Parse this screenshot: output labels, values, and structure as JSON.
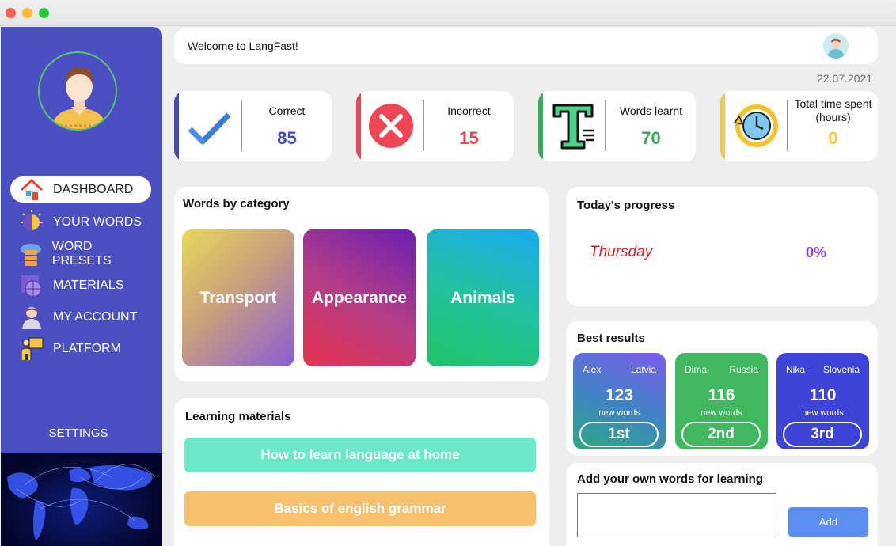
{
  "window": {
    "controls": [
      "close",
      "minimize",
      "maximize"
    ]
  },
  "header": {
    "welcome": "Welcome to LangFast!",
    "date": "22.07.2021"
  },
  "sidebar": {
    "items": [
      {
        "label": "DASHBOARD",
        "icon": "house-icon",
        "active": true
      },
      {
        "label": "YOUR WORDS",
        "icon": "brain-bulb-icon"
      },
      {
        "label": "WORD PRESETS",
        "icon": "server-cloud-icon"
      },
      {
        "label": "MATERIALS",
        "icon": "book-globe-icon"
      },
      {
        "label": "MY ACCOUNT",
        "icon": "user-icon"
      },
      {
        "label": "PLATFORM",
        "icon": "teacher-board-icon"
      }
    ],
    "settings": "SETTINGS"
  },
  "stats": [
    {
      "label": "Correct",
      "value": "85",
      "color": "#3f4ab8",
      "icon": "checkmark-icon"
    },
    {
      "label": "Incorrect",
      "value": "15",
      "color": "#ef4655",
      "icon": "x-circle-icon"
    },
    {
      "label": "Words learnt",
      "value": "70",
      "color": "#3aaa5c",
      "icon": "text-t-icon"
    },
    {
      "label": "Total time spent (hours)",
      "value": "0",
      "color": "#f2c94c",
      "icon": "clock-history-icon"
    }
  ],
  "categories": {
    "title": "Words by category",
    "items": [
      "Transport",
      "Appearance",
      "Animals"
    ]
  },
  "progress": {
    "title": "Today's progress",
    "day": "Thursday",
    "percent": "0%"
  },
  "materials": {
    "title": "Learning materials",
    "items": [
      "How to learn language at home",
      "Basics of english grammar"
    ]
  },
  "results": {
    "title": "Best results",
    "items": [
      {
        "name": "Alex",
        "country": "Latvia",
        "value": "123",
        "unit": "new words",
        "place": "1st"
      },
      {
        "name": "Dima",
        "country": "Russia",
        "value": "116",
        "unit": "new words",
        "place": "2nd"
      },
      {
        "name": "Nika",
        "country": "Slovenia",
        "value": "110",
        "unit": "new words",
        "place": "3rd"
      }
    ]
  },
  "addwords": {
    "title": "Add your own words for learning",
    "input_value": "",
    "button": "Add"
  }
}
